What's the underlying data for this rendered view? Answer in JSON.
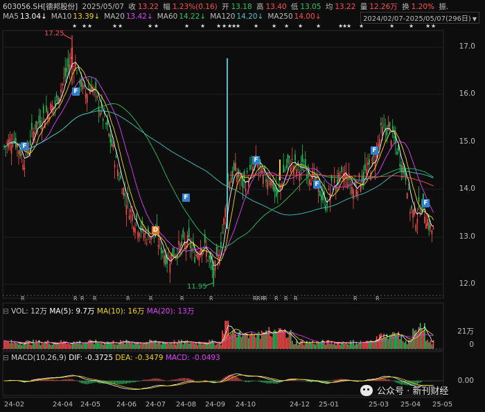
{
  "header": {
    "symbol": "603056.SH[德邦股份]",
    "date": "2025/05/07",
    "close_label": "收",
    "close": "13.22",
    "amp_label": "幅",
    "amp": "1.23%(0.16)",
    "open_label": "开",
    "open": "13.18",
    "high_label": "高",
    "high": "13.40",
    "low_label": "低",
    "low": "13.05",
    "avg_label": "均",
    "avg": "13.22",
    "vol_label": "量",
    "vol": "12.26万",
    "turn_label": "换",
    "turn": "1.20%",
    "amp2_label": "振.",
    "ma": [
      {
        "label": "MA5",
        "value": "13.04↓",
        "color": "#ffffff"
      },
      {
        "label": "MA10",
        "value": "13.39↓",
        "color": "#f5d60c"
      },
      {
        "label": "MA20",
        "value": "13.42↓",
        "color": "#e040fb"
      },
      {
        "label": "MA60",
        "value": "14.22↓",
        "color": "#22c55e"
      },
      {
        "label": "MA120",
        "value": "14.20↓",
        "color": "#40c4c4"
      },
      {
        "label": "MA250",
        "value": "14.00↓",
        "color": "#ff4d4d"
      }
    ],
    "date_range": "2024/02/07-2025/05/07(296日)"
  },
  "icons": {
    "dropdown": "chevron-down-icon",
    "wechat": "wechat-icon"
  },
  "price_axis": [
    "17.0",
    "16.0",
    "15.0",
    "14.0",
    "13.0",
    "12.0"
  ],
  "annotations": {
    "high": "17.25",
    "low": "11.95"
  },
  "markers": [
    "F",
    "F",
    "F",
    "D",
    "F",
    "F",
    "F",
    "F"
  ],
  "r_tags": [
    "R",
    "R",
    "R",
    "R",
    "R",
    "R",
    "R",
    "R",
    "R",
    "R",
    "R",
    "R",
    "R",
    "R",
    "R",
    "R",
    "R"
  ],
  "volume": {
    "label": "VOL: 12万",
    "ma5": "MA(5): 9.7万",
    "ma10": "MA(10): 16万",
    "ma20": "MA(20): 13万",
    "axis": [
      "21万",
      "0"
    ]
  },
  "macd": {
    "label": "MACD(10,26,9)",
    "dif": "DIF: -0.3725",
    "dea": "DEA: -0.3479",
    "macd": "MACD: -0.0493",
    "axis": [
      "0.00"
    ]
  },
  "x_axis": [
    "24-02",
    "24-04",
    "24-05",
    "24-06",
    "24-07",
    "24-08",
    "24-09",
    "24-10",
    "24-12",
    "25-01",
    "25-03",
    "25-04",
    "25-05"
  ],
  "watermark": "公众号 · 新刊财经",
  "colors": {
    "up": "#ff4d4d",
    "down": "#22c55e",
    "background": "#0d0d0d"
  }
}
